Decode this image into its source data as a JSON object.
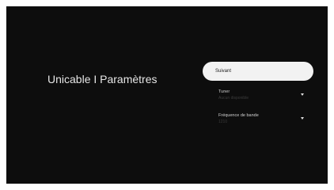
{
  "page": {
    "title": "Unicable I Paramètres"
  },
  "panel": {
    "next_label": "Suivant",
    "items": [
      {
        "label": "Tuner",
        "value": "Aucun disponible",
        "icon": "chevron-down-icon"
      },
      {
        "label": "Fréquence de bande",
        "value": "1210",
        "icon": "chevron-down-icon"
      }
    ]
  },
  "colors": {
    "screen_background": "#0d0d0d",
    "button_background": "#f2f2f2",
    "title_text": "#e6e6e6"
  }
}
